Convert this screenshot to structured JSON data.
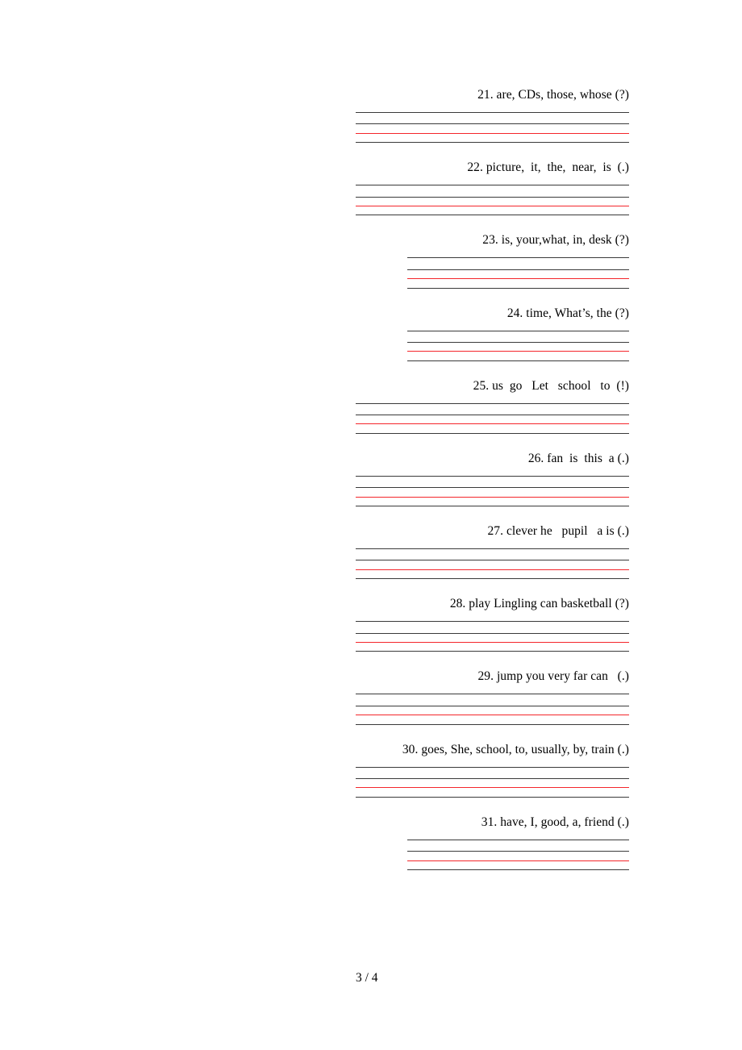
{
  "document": {
    "type": "english-word-ordering-worksheet",
    "page_label": "3 / 4"
  },
  "colors": {
    "rule_dark": "#3a3a3a",
    "rule_red": "#f4262b",
    "text": "#000000",
    "page_background": "#ffffff"
  },
  "exercises": [
    {
      "number": "21.",
      "text": "21. are, CDs, those, whose (?)",
      "line_width": "wide"
    },
    {
      "number": "22.",
      "text": "22. picture,  it,  the,  near,  is  (.)",
      "line_width": "wide"
    },
    {
      "number": "23.",
      "text": "23. is, your,what, in, desk (?)",
      "line_width": "narrow"
    },
    {
      "number": "24.",
      "text": "24. time, What’s, the (?)",
      "line_width": "narrow"
    },
    {
      "number": "25.",
      "text": "25. us  go   Let   school   to  (!)",
      "line_width": "wide"
    },
    {
      "number": "26.",
      "text": "26. fan  is  this  a (.)",
      "line_width": "wide"
    },
    {
      "number": "27.",
      "text": "27. clever he   pupil   a is (.)",
      "line_width": "wide"
    },
    {
      "number": "28.",
      "text": "28. play Lingling can basketball (?)",
      "line_width": "wide"
    },
    {
      "number": "29.",
      "text": "29. jump you very far can   (.)",
      "line_width": "wide"
    },
    {
      "number": "30.",
      "text": "30. goes, She, school, to, usually, by, train (.)",
      "line_width": "wide"
    },
    {
      "number": "31.",
      "text": "31. have, I, good, a, friend (.)",
      "line_width": "narrow"
    }
  ],
  "writing_lines": {
    "rules_per_group": 4,
    "pattern": [
      "dark",
      "dark",
      "red",
      "dark"
    ]
  },
  "footer": {
    "page_number": "3 / 4"
  }
}
